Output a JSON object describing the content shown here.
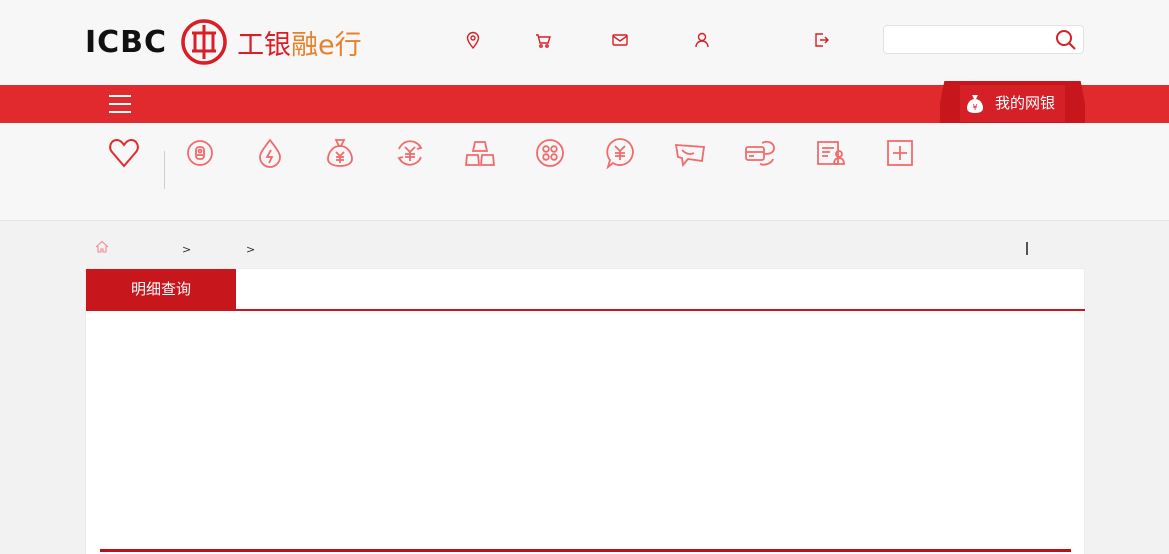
{
  "header": {
    "logo_text": "ICBC",
    "logo_cn_first": "工银",
    "logo_cn_rest": "融e行",
    "icons": [
      "location-icon",
      "cart-icon",
      "mail-icon",
      "user-icon",
      "logout-icon"
    ],
    "search": {
      "placeholder": "",
      "value": ""
    }
  },
  "navbar": {
    "mybank_label": "我的网银"
  },
  "categories": {
    "icons": [
      "favorite-heart-icon",
      "deposit-icon",
      "bill-payment-icon",
      "money-bag-icon",
      "exchange-icon",
      "gold-bars-icon",
      "precious-metal-icon",
      "loan-consult-icon",
      "remittance-icon",
      "credit-card-icon",
      "account-manage-icon",
      "add-icon"
    ]
  },
  "breadcrumb": {
    "separator1": ">",
    "separator2": ">"
  },
  "panel": {
    "active_tab": "明细查询"
  },
  "colors": {
    "brand_red": "#e12a2e",
    "dark_red": "#c8161d",
    "icon_pink": "#f26b6b"
  }
}
